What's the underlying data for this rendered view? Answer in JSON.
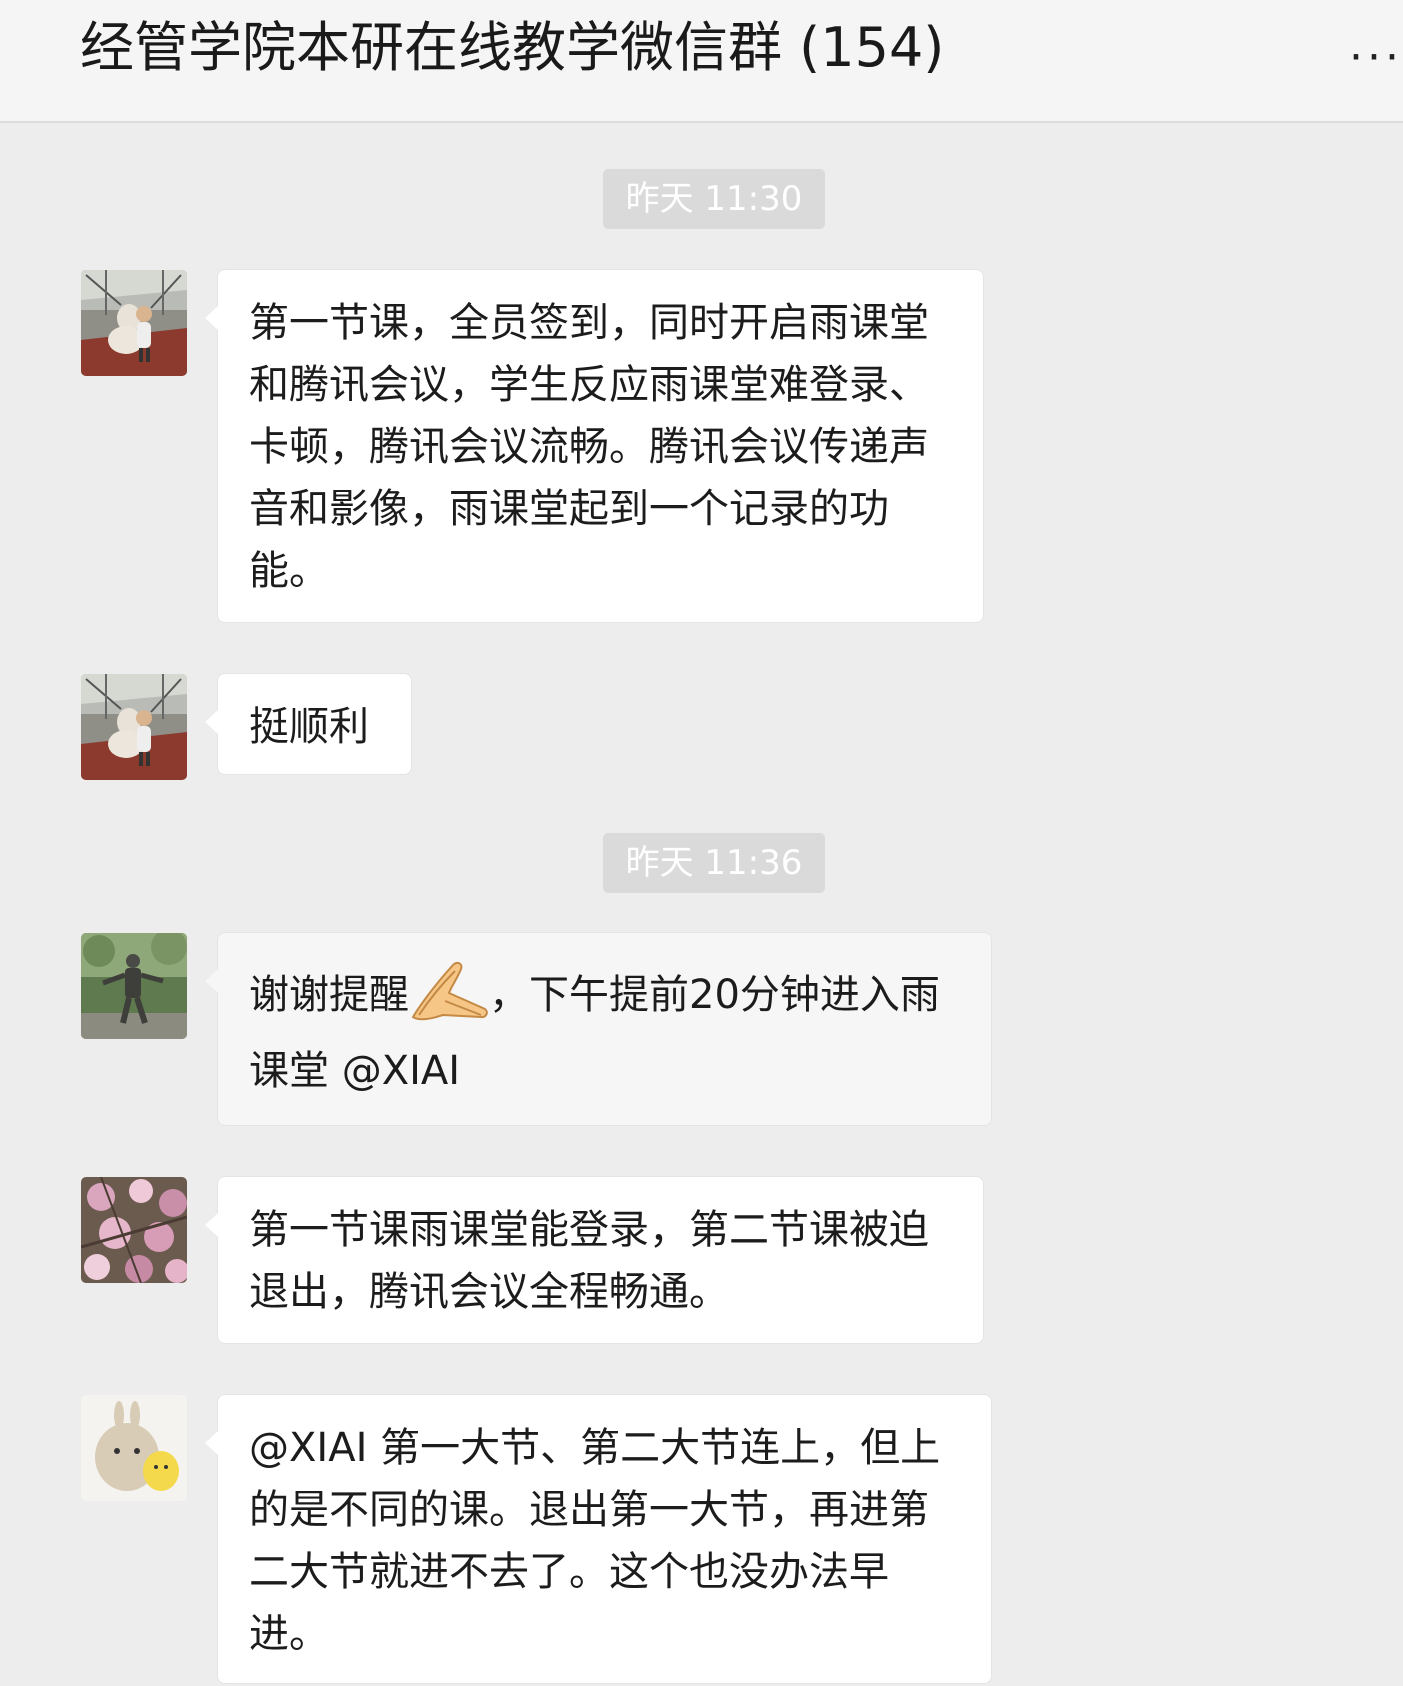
{
  "header": {
    "title": "经管学院本研在线教学微信群 (154)",
    "more_label": "···"
  },
  "timestamps": [
    "昨天 11:30",
    "昨天 11:36"
  ],
  "messages": [
    {
      "text": "第一节课，全员签到，同时开启雨课堂和腾讯会议，学生反应雨课堂难登录、卡顿，腾讯会议流畅。腾讯会议传递声音和影像，雨课堂起到一个记录的功能。"
    },
    {
      "text": "挺顺利"
    },
    {
      "text_before": "谢谢提醒",
      "emoji": "folded-hands-emoji",
      "text_after": "，下午提前20分钟进入雨课堂 @XIAI"
    },
    {
      "text": "第一节课雨课堂能登录，第二节课被迫退出，腾讯会议全程畅通。"
    },
    {
      "text": "@XIAI 第一大节、第二大节连上，但上的是不同的课。退出第一大节，再进第二大节就进不去了。这个也没办法早进。"
    }
  ],
  "colors": {
    "background": "#ededed",
    "header_background": "#f5f5f5",
    "bubble": "#ffffff",
    "timestamp_pill": "#dadada"
  }
}
